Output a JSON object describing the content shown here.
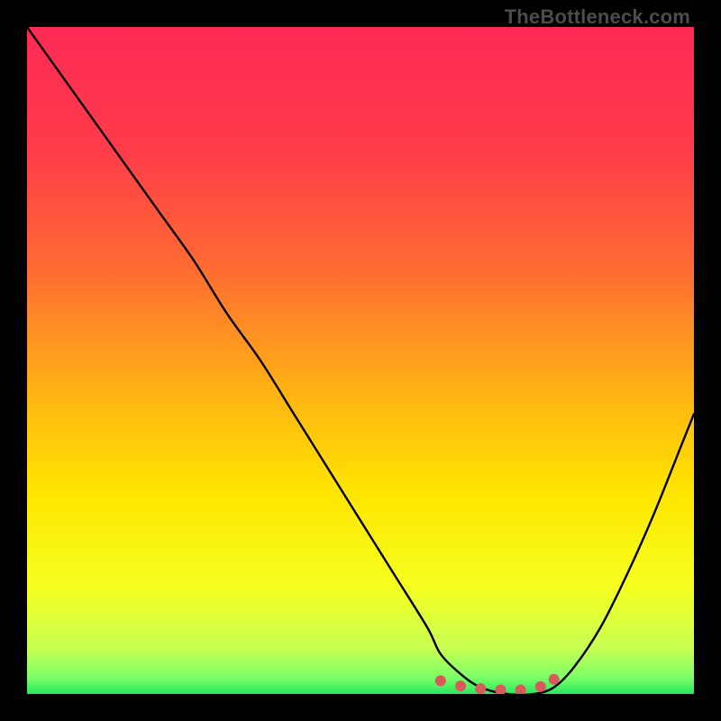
{
  "watermark": "TheBottleneck.com",
  "chart_data": {
    "type": "line",
    "title": "",
    "xlabel": "",
    "ylabel": "",
    "xlim": [
      0,
      100
    ],
    "ylim": [
      0,
      100
    ],
    "background_gradient_stops": [
      {
        "pos": 0.0,
        "color": "#ff2a55"
      },
      {
        "pos": 0.18,
        "color": "#ff3b4a"
      },
      {
        "pos": 0.36,
        "color": "#ff6a33"
      },
      {
        "pos": 0.54,
        "color": "#ffb014"
      },
      {
        "pos": 0.7,
        "color": "#ffe600"
      },
      {
        "pos": 0.84,
        "color": "#f5ff1f"
      },
      {
        "pos": 0.93,
        "color": "#c9ff52"
      },
      {
        "pos": 0.975,
        "color": "#7dff66"
      },
      {
        "pos": 1.0,
        "color": "#27e85f"
      }
    ],
    "series": [
      {
        "name": "bottleneck-curve",
        "color": "#000000",
        "x": [
          0,
          5,
          10,
          15,
          20,
          25,
          30,
          35,
          40,
          45,
          50,
          55,
          60,
          62,
          65,
          68,
          72,
          76,
          79,
          82,
          86,
          90,
          94,
          98,
          100
        ],
        "y": [
          100,
          93,
          86,
          79,
          72,
          65,
          57,
          50,
          42,
          34,
          26,
          18,
          10,
          6,
          3,
          1,
          0,
          0,
          1,
          4,
          10,
          18,
          27,
          37,
          42
        ]
      }
    ],
    "markers": {
      "name": "valley-markers",
      "color": "#d85a5a",
      "points": [
        {
          "x": 62,
          "y": 2.0
        },
        {
          "x": 65,
          "y": 1.2
        },
        {
          "x": 68,
          "y": 0.8
        },
        {
          "x": 71,
          "y": 0.6
        },
        {
          "x": 74,
          "y": 0.6
        },
        {
          "x": 77,
          "y": 1.1
        },
        {
          "x": 79,
          "y": 2.2
        }
      ]
    }
  }
}
